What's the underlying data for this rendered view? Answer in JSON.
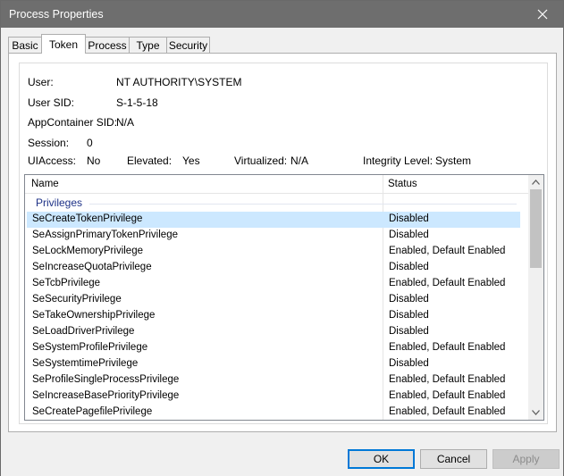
{
  "window": {
    "title": "Process Properties",
    "close_icon": "close-icon"
  },
  "tabs": [
    {
      "label": "Basic",
      "active": false
    },
    {
      "label": "Token",
      "active": true
    },
    {
      "label": "Process",
      "active": false
    },
    {
      "label": "Type",
      "active": false
    },
    {
      "label": "Security",
      "active": false
    }
  ],
  "token": {
    "user_label": "User:",
    "user_value": "NT AUTHORITY\\SYSTEM",
    "sid_label": "User SID:",
    "sid_value": "S-1-5-18",
    "appcontainer_label": "AppContainer SID:",
    "appcontainer_value": "N/A",
    "session_label": "Session:",
    "session_value": "0",
    "uiaccess_label": "UIAccess:",
    "uiaccess_value": "No",
    "elevated_label": "Elevated:",
    "elevated_value": "Yes",
    "virtualized_label": "Virtualized:",
    "virtualized_value": "N/A",
    "integrity_label": "Integrity Level:",
    "integrity_value": "System"
  },
  "list": {
    "columns": [
      "Name",
      "Status"
    ],
    "group": "Privileges",
    "rows": [
      {
        "name": "SeCreateTokenPrivilege",
        "status": "Disabled",
        "selected": true
      },
      {
        "name": "SeAssignPrimaryTokenPrivilege",
        "status": "Disabled"
      },
      {
        "name": "SeLockMemoryPrivilege",
        "status": "Enabled, Default Enabled"
      },
      {
        "name": "SeIncreaseQuotaPrivilege",
        "status": "Disabled"
      },
      {
        "name": "SeTcbPrivilege",
        "status": "Enabled, Default Enabled"
      },
      {
        "name": "SeSecurityPrivilege",
        "status": "Disabled"
      },
      {
        "name": "SeTakeOwnershipPrivilege",
        "status": "Disabled"
      },
      {
        "name": "SeLoadDriverPrivilege",
        "status": "Disabled"
      },
      {
        "name": "SeSystemProfilePrivilege",
        "status": "Enabled, Default Enabled"
      },
      {
        "name": "SeSystemtimePrivilege",
        "status": "Disabled"
      },
      {
        "name": "SeProfileSingleProcessPrivilege",
        "status": "Enabled, Default Enabled"
      },
      {
        "name": "SeIncreaseBasePriorityPrivilege",
        "status": "Enabled, Default Enabled"
      },
      {
        "name": "SeCreatePagefilePrivilege",
        "status": "Enabled, Default Enabled"
      }
    ]
  },
  "buttons": {
    "ok": "OK",
    "cancel": "Cancel",
    "apply": "Apply"
  },
  "colors": {
    "titlebar": "#6e6e6e",
    "selection": "#cce8ff",
    "group_label": "#1e3287",
    "default_button_border": "#0078d7"
  }
}
